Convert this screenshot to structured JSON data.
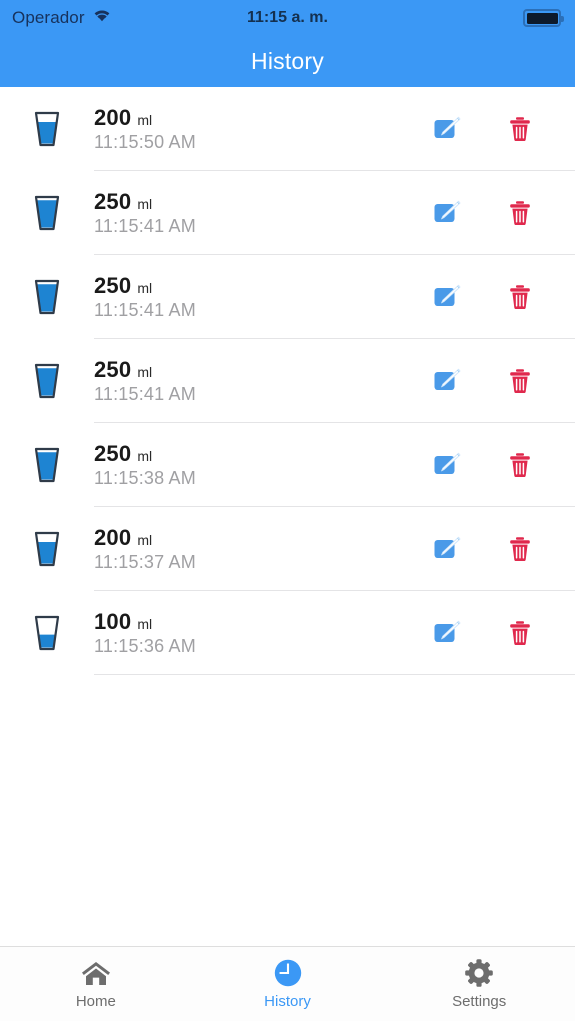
{
  "status_bar": {
    "carrier": "Operador",
    "wifi_icon": "wifi-icon",
    "time": "11:15 a. m.",
    "battery_icon": "battery-full-icon"
  },
  "nav": {
    "title": "History"
  },
  "colors": {
    "accent": "#3b98f5",
    "edit": "#4a9ae8",
    "delete": "#e0294d",
    "water": "#1e84d2",
    "tab_inactive": "#6d6d6d"
  },
  "list": {
    "unit": "ml",
    "edit_icon": "edit-pencil-icon",
    "delete_icon": "trash-icon",
    "glass_icon": "water-glass-icon",
    "rows": [
      {
        "amount": "200",
        "unit": "ml",
        "time": "11:15:50 AM",
        "fill": 72
      },
      {
        "amount": "250",
        "unit": "ml",
        "time": "11:15:41 AM",
        "fill": 90
      },
      {
        "amount": "250",
        "unit": "ml",
        "time": "11:15:41 AM",
        "fill": 90
      },
      {
        "amount": "250",
        "unit": "ml",
        "time": "11:15:41 AM",
        "fill": 90
      },
      {
        "amount": "250",
        "unit": "ml",
        "time": "11:15:38 AM",
        "fill": 90
      },
      {
        "amount": "200",
        "unit": "ml",
        "time": "11:15:37 AM",
        "fill": 72
      },
      {
        "amount": "100",
        "unit": "ml",
        "time": "11:15:36 AM",
        "fill": 45
      }
    ]
  },
  "tabs": [
    {
      "label": "Home",
      "icon": "home-icon",
      "active": false
    },
    {
      "label": "History",
      "icon": "clock-icon",
      "active": true
    },
    {
      "label": "Settings",
      "icon": "gear-icon",
      "active": false
    }
  ]
}
